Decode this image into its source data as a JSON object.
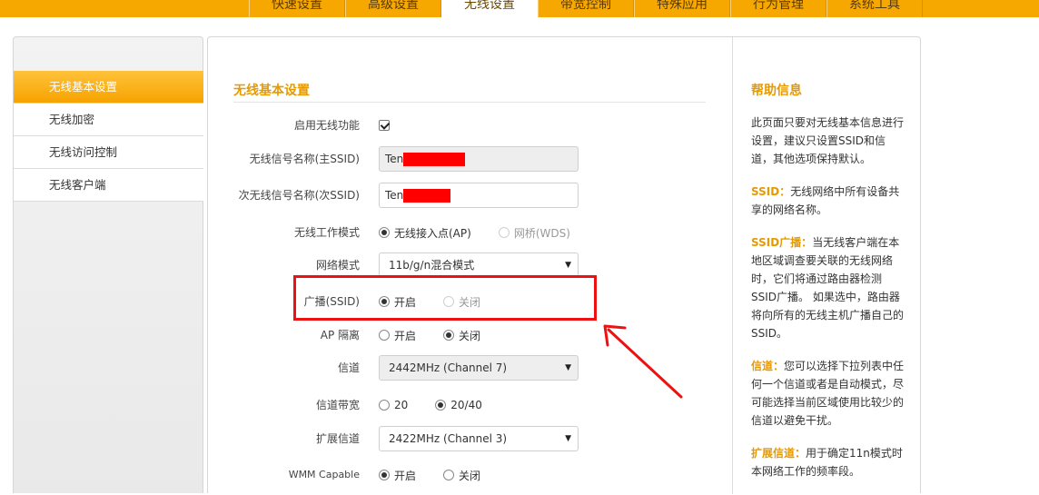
{
  "nav": {
    "tabs": [
      "快速设置",
      "高级设置",
      "无线设置",
      "带宽控制",
      "特殊应用",
      "行为管理",
      "系统工具"
    ],
    "active_index": 2
  },
  "sidebar": {
    "items": [
      "无线基本设置",
      "无线加密",
      "无线访问控制",
      "无线客户端"
    ],
    "active_index": 0
  },
  "form": {
    "title": "无线基本设置",
    "enable_label": "启用无线功能",
    "ssid_main_label": "无线信号名称(主SSID)",
    "ssid_main_value": "Ten",
    "ssid_sub_label": "次无线信号名称(次SSID)",
    "ssid_sub_value": "Ten",
    "mode_label": "无线工作模式",
    "mode_ap": "无线接入点(AP)",
    "mode_wds": "网桥(WDS)",
    "netmode_label": "网络模式",
    "netmode_value": "11b/g/n混合模式",
    "broadcast_label": "广播(SSID)",
    "on": "开启",
    "off": "关闭",
    "ap_isolation_label": "AP 隔离",
    "channel_label": "信道",
    "channel_value": "2442MHz (Channel 7)",
    "bandwidth_label": "信道带宽",
    "bw_20": "20",
    "bw_2040": "20/40",
    "ext_channel_label": "扩展信道",
    "ext_channel_value": "2422MHz (Channel 3)",
    "wmm_label": "WMM Capable"
  },
  "help": {
    "title": "帮助信息",
    "intro": "此页面只要对无线基本信息进行设置，建议只设置SSID和信道，其他选项保持默认。",
    "ssid_kw": "SSID：",
    "ssid_text": "无线网络中所有设备共享的网络名称。",
    "bcast_kw": "SSID广播：",
    "bcast_text": "当无线客户端在本地区域调查要关联的无线网络时，它们将通过路由器检测SSID广播。 如果选中，路由器将向所有的无线主机广播自己的SSID。",
    "ch_kw": "信道：",
    "ch_text": "您可以选择下拉列表中任何一个信道或者是自动模式，尽可能选择当前区域使用比较少的信道以避免干扰。",
    "ext_kw": "扩展信道：",
    "ext_text": "用于确定11n模式时本网络工作的频率段。"
  },
  "colors": {
    "accent": "#f7a800",
    "annotation": "#ee1111"
  }
}
